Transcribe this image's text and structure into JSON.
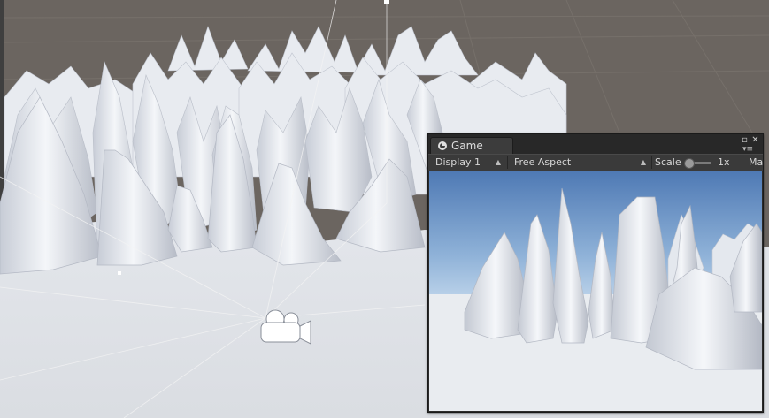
{
  "game_window": {
    "tab_label": "Game",
    "toolbar": {
      "display_label": "Display 1",
      "aspect_label": "Free Aspect",
      "scale_label": "Scale",
      "scale_value": "1x",
      "scale_fraction": 0.0,
      "maximize_label": "Ma"
    }
  },
  "icons": {
    "camera": "camera-icon",
    "tab": "unity-game-icon",
    "maximize": "maximize-icon",
    "close": "close-icon",
    "menu": "menu-icon"
  },
  "colors": {
    "grid_background": "#6b6560",
    "snow": "#eef1f4",
    "sky_top": "#4e79b4",
    "sky_horizon": "#c9dcef",
    "editor_panel": "#3a3a3a"
  }
}
